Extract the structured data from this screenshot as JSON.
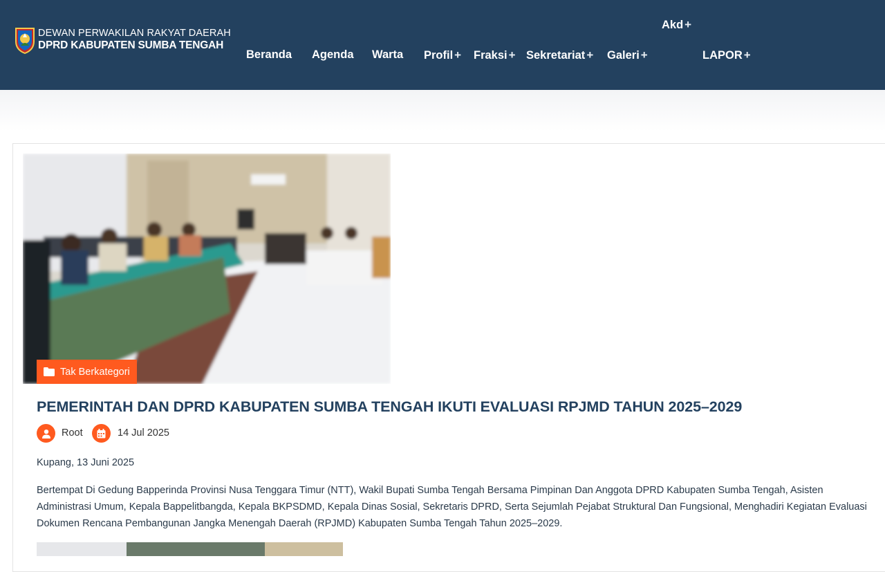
{
  "header": {
    "brand_line1": "DEWAN PERWAKILAN RAKYAT DAERAH",
    "brand_line2": "DPRD KABUPATEN SUMBA TENGAH",
    "logo_icon": "regional-emblem-icon",
    "bg_color": "#23415f",
    "nav": [
      {
        "label": "Beranda"
      },
      {
        "label": "Agenda"
      },
      {
        "label": "Warta"
      },
      {
        "label": "Profil",
        "plus": "+"
      },
      {
        "label": "Fraksi",
        "plus": "+"
      },
      {
        "label": "Sekretariat",
        "plus": "+"
      },
      {
        "label": "Galeri",
        "plus": "+"
      },
      {
        "label": "Akd",
        "plus": "+"
      },
      {
        "label": "LAPOR",
        "plus": "+"
      }
    ]
  },
  "post": {
    "category": "Tak Berkategori",
    "category_icon": "folder-icon",
    "title": "PEMERINTAH DAN DPRD KABUPATEN SUMBA TENGAH IKUTI EVALUASI RPJMD TAHUN 2025–2029",
    "author": "Root",
    "author_icon": "user-icon",
    "date": "14 Jul 2025",
    "date_icon": "calendar-icon",
    "dateline": "Kupang, 13 Juni 2025",
    "body": "Bertempat Di Gedung Bapperinda Provinsi Nusa Tenggara Timur (NTT), Wakil Bupati Sumba Tengah Bersama Pimpinan Dan Anggota DPRD Kabupaten Sumba Tengah, Asisten Administrasi Umum, Kepala Bappelitbangda, Kepala BKPSDMD, Kepala Dinas Sosial, Sekretaris DPRD, Serta Sejumlah Pejabat Struktural Dan Fungsional, Menghadiri Kegiatan Evaluasi Dokumen Rencana Pembangunan Jangka Menengah Daerah (RPJMD) Kabupaten Sumba Tengah Tahun 2025–2029."
  },
  "colors": {
    "accent": "#ff5a1f",
    "title": "#23415f"
  }
}
